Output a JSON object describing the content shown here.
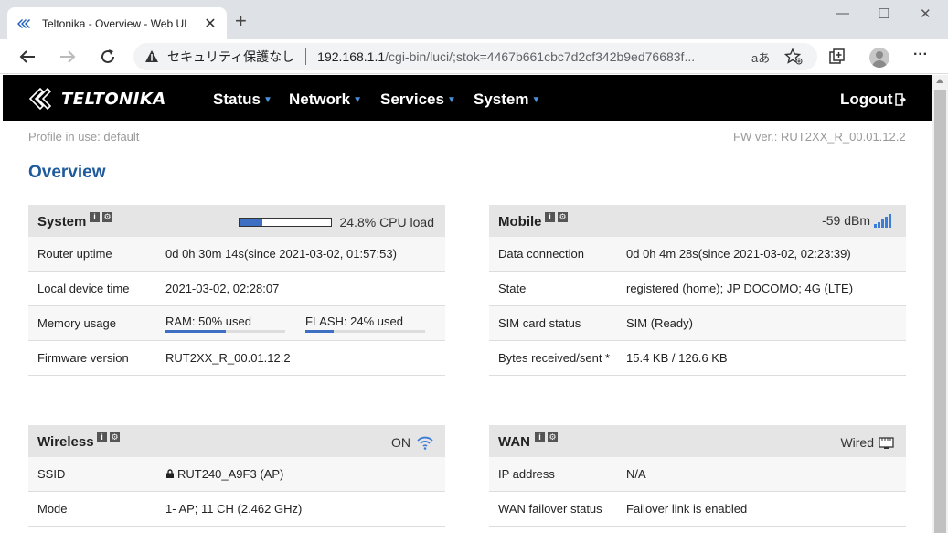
{
  "browser": {
    "tab_title": "Teltonika - Overview - Web UI",
    "tab_close": "✕",
    "new_tab": "+",
    "minimize": "—",
    "maximize": "☐",
    "close": "✕",
    "security_label": "セキュリティ保護なし",
    "url_host": "192.168.1.1",
    "url_path": "/cgi-bin/luci/;stok=4467b661cbc7d2cf342b9ed76683f...",
    "read_aloud": "aあ",
    "more": "···"
  },
  "nav": {
    "logo": "TELTONIKA",
    "menu": [
      "Status",
      "Network",
      "Services",
      "System"
    ],
    "logout": "Logout"
  },
  "page": {
    "profile": "Profile in use: default",
    "fw": "FW ver.: RUT2XX_R_00.01.12.2",
    "title": "Overview"
  },
  "system": {
    "title": "System",
    "cpu_text": "24.8% CPU load",
    "cpu_fraction": 0.248,
    "rows": [
      {
        "k": "Router uptime",
        "v": "0d 0h 30m 14s(since 2021-03-02, 01:57:53)"
      },
      {
        "k": "Local device time",
        "v": "2021-03-02, 02:28:07"
      },
      {
        "k": "Memory usage"
      },
      {
        "k": "Firmware version",
        "v": "RUT2XX_R_00.01.12.2"
      }
    ],
    "ram_text": "RAM: 50% used",
    "ram_fraction": 0.5,
    "flash_text": "FLASH: 24% used",
    "flash_fraction": 0.24
  },
  "mobile": {
    "title": "Mobile",
    "signal": "-59 dBm",
    "rows": [
      {
        "k": "Data connection",
        "v": "0d 0h 4m 28s(since 2021-03-02, 02:23:39)"
      },
      {
        "k": "State",
        "v": "registered (home); JP DOCOMO; 4G (LTE)"
      },
      {
        "k": "SIM card status",
        "v": "SIM (Ready)"
      },
      {
        "k": "Bytes received/sent *",
        "v": "15.4 KB / 126.6 KB"
      }
    ]
  },
  "wireless": {
    "title": "Wireless",
    "status": "ON",
    "rows": [
      {
        "k": "SSID",
        "v": "RUT240_A9F3 (AP)"
      },
      {
        "k": "Mode",
        "v": "1- AP; 11 CH (2.462 GHz)"
      }
    ]
  },
  "wan": {
    "title": "WAN",
    "status": "Wired",
    "rows": [
      {
        "k": "IP address",
        "v": "N/A"
      },
      {
        "k": "WAN failover status",
        "v": "Failover link is enabled"
      }
    ]
  },
  "colors": {
    "accent": "#1f5b9c",
    "bar": "#3d6fc2",
    "nav": "#000000"
  }
}
